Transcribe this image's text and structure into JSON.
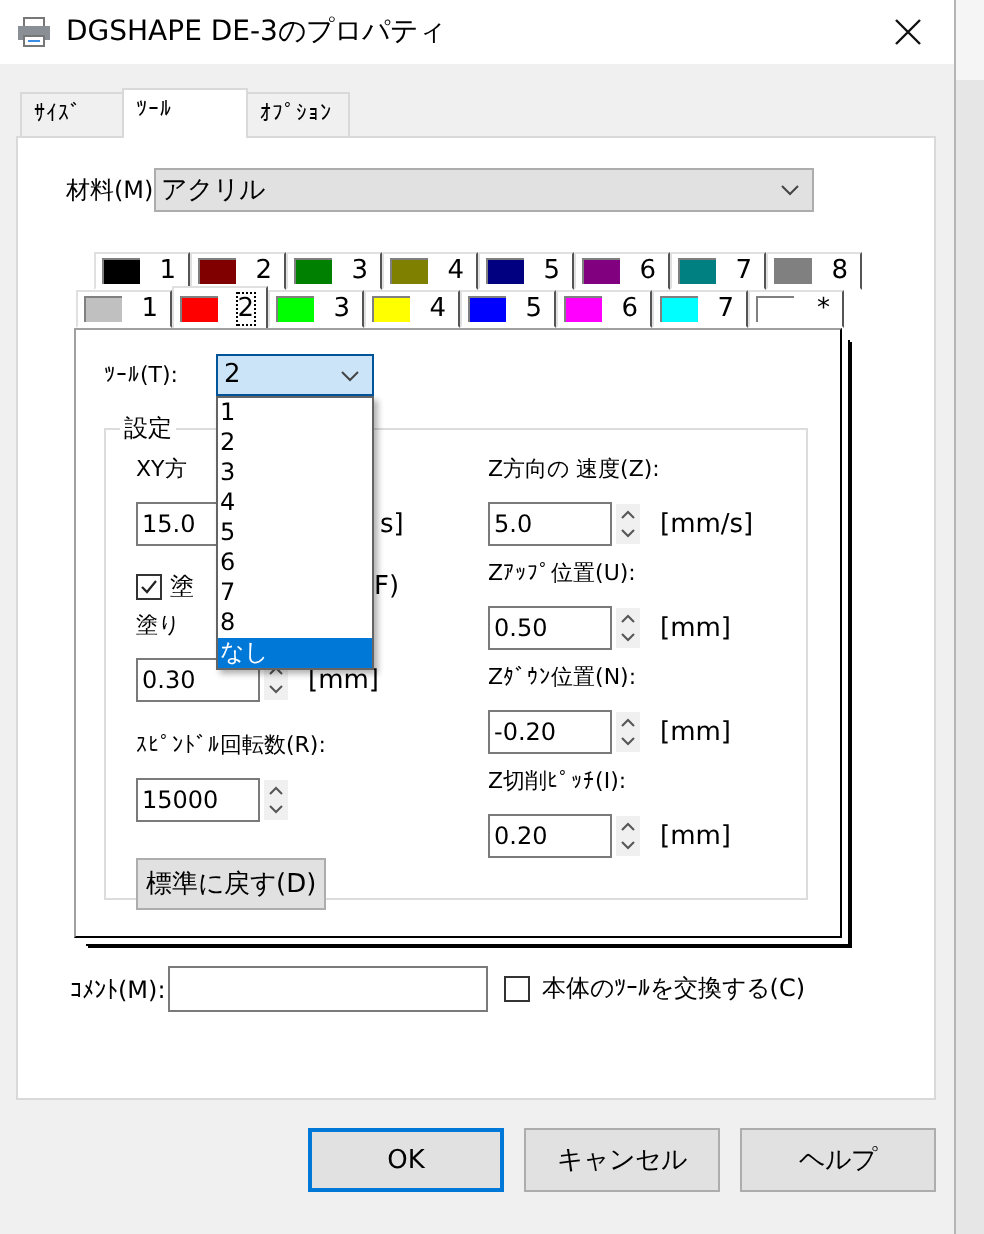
{
  "window": {
    "title": "DGSHAPE DE-3のプロパティ"
  },
  "tabs": [
    {
      "label": "ｻｲｽﾞ",
      "selected": false
    },
    {
      "label": "ﾂｰﾙ",
      "selected": true
    },
    {
      "label": "ｵﾌﾟｼｮﾝ",
      "selected": false
    }
  ],
  "material": {
    "label": "材料(M)",
    "value": "アクリル"
  },
  "pen_tabs_back": [
    {
      "label": "1",
      "color": "#000000",
      "selected": false
    },
    {
      "label": "2",
      "color": "#800000",
      "selected": false
    },
    {
      "label": "3",
      "color": "#008000",
      "selected": false
    },
    {
      "label": "4",
      "color": "#808000",
      "selected": false
    },
    {
      "label": "5",
      "color": "#000080",
      "selected": false
    },
    {
      "label": "6",
      "color": "#800080",
      "selected": false
    },
    {
      "label": "7",
      "color": "#008080",
      "selected": false
    },
    {
      "label": "8",
      "color": "#808080",
      "selected": false
    }
  ],
  "pen_tabs_front": [
    {
      "label": "1",
      "color": "#c0c0c0",
      "selected": false
    },
    {
      "label": "2",
      "color": "#ff0000",
      "selected": true
    },
    {
      "label": "3",
      "color": "#00ff00",
      "selected": false
    },
    {
      "label": "4",
      "color": "#ffff00",
      "selected": false
    },
    {
      "label": "5",
      "color": "#0000ff",
      "selected": false
    },
    {
      "label": "6",
      "color": "#ff00ff",
      "selected": false
    },
    {
      "label": "7",
      "color": "#00ffff",
      "selected": false
    },
    {
      "label": "*",
      "color": "#ffffff",
      "selected": false
    }
  ],
  "tool": {
    "label": "ﾂｰﾙ(T):",
    "value": "2",
    "options": [
      {
        "label": "1",
        "highlighted": false
      },
      {
        "label": "2",
        "highlighted": false
      },
      {
        "label": "3",
        "highlighted": false
      },
      {
        "label": "4",
        "highlighted": false
      },
      {
        "label": "5",
        "highlighted": false
      },
      {
        "label": "6",
        "highlighted": false
      },
      {
        "label": "7",
        "highlighted": false
      },
      {
        "label": "8",
        "highlighted": false
      },
      {
        "label": "なし",
        "highlighted": true
      }
    ]
  },
  "group": {
    "title": "設定",
    "xy_speed": {
      "label": "XY方",
      "value": "15.0",
      "unit": "s]"
    },
    "fill": {
      "label": "塗",
      "label_end": "F)",
      "checked": true
    },
    "fill_pitch": {
      "label": "塗り",
      "value": "0.30",
      "unit": "[mm]"
    },
    "spindle": {
      "label": "ｽﾋﾟﾝﾄﾞﾙ回転数(R):",
      "value": "15000"
    },
    "reset_button": "標準に戻す(D)",
    "z_fields": [
      {
        "label": "Z方向の 速度(Z):",
        "value": "5.0",
        "unit": "[mm/s]"
      },
      {
        "label": "Zｱｯﾌﾟ位置(U):",
        "value": "0.50",
        "unit": "[mm]"
      },
      {
        "label": "Zﾀﾞｳﾝ位置(N):",
        "value": "-0.20",
        "unit": "[mm]"
      },
      {
        "label": "Z切削ﾋﾟｯﾁ(I):",
        "value": "0.20",
        "unit": "[mm]"
      }
    ]
  },
  "comment": {
    "label": "ｺﾒﾝﾄ(M):"
  },
  "exchange": {
    "label": "本体のﾂｰﾙを交換する(C)",
    "checked": false
  },
  "buttons": [
    {
      "label": "OK",
      "default": true
    },
    {
      "label": "キャンセル",
      "default": false
    },
    {
      "label": "ヘルプ",
      "default": false
    }
  ]
}
